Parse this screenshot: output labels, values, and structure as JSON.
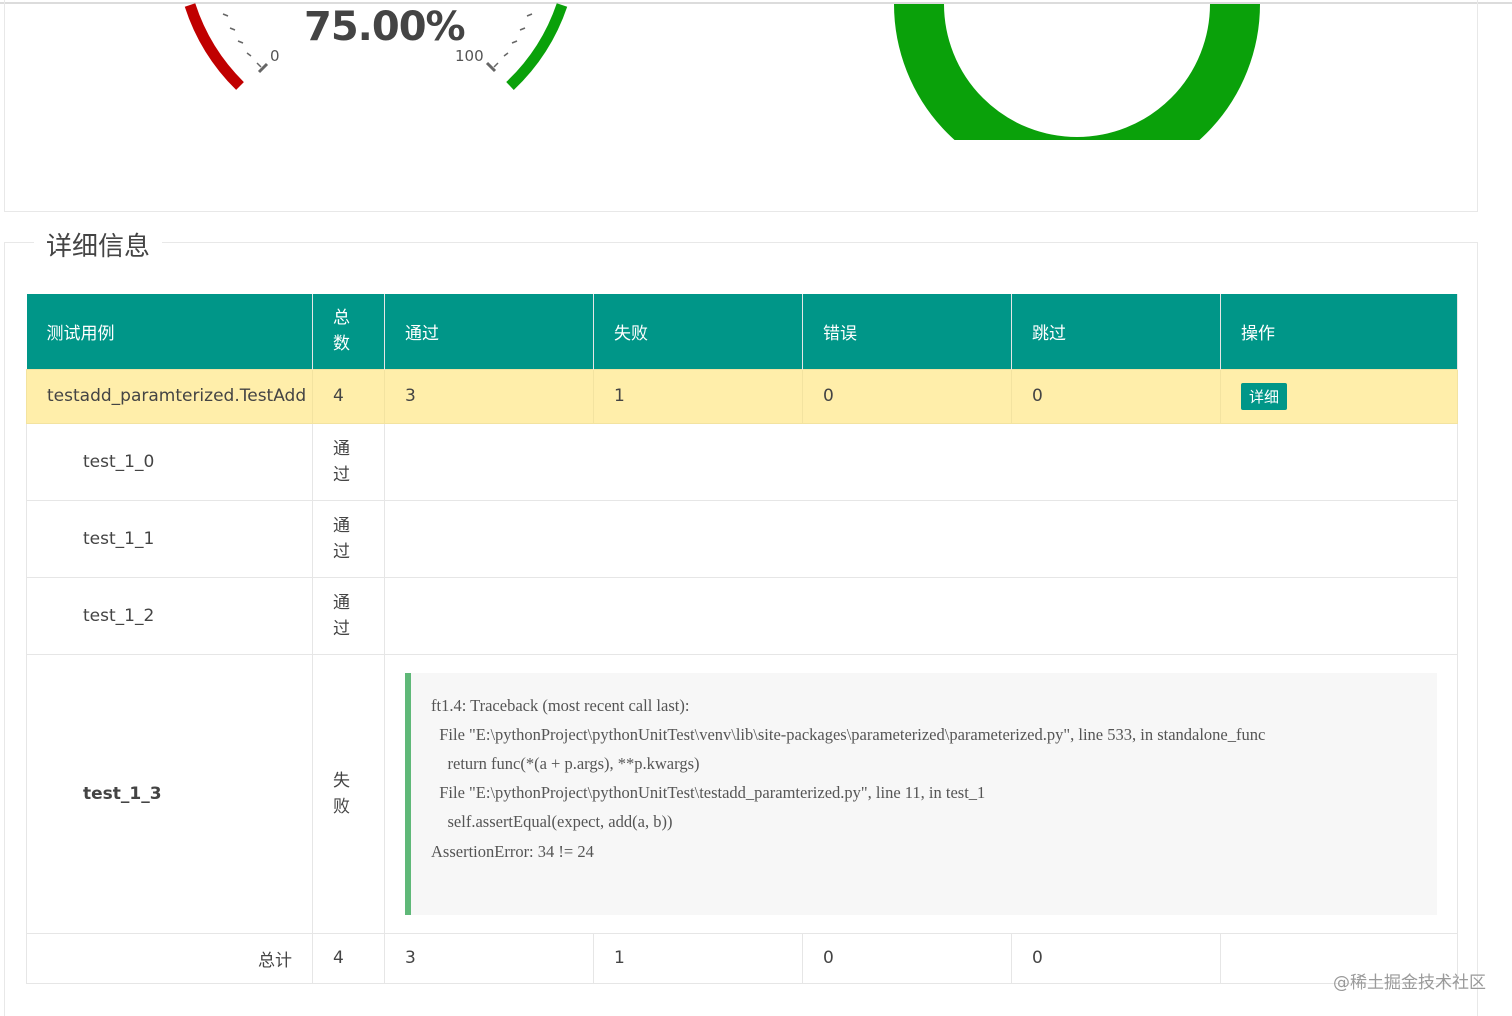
{
  "gauge": {
    "value_text": "75.00%",
    "percent": 75,
    "min_label": "0",
    "max_label": "100",
    "colors": {
      "low": "#c00000",
      "high": "#0aa10a"
    }
  },
  "donut": {
    "color": "#0aa10a"
  },
  "details": {
    "legend": "详细信息",
    "headers": [
      "测试用例",
      "总数",
      "通过",
      "失败",
      "错误",
      "跳过",
      "操作"
    ],
    "class_row": {
      "name": "testadd_paramterized.TestAdd",
      "total": "4",
      "pass": "3",
      "fail": "1",
      "error": "0",
      "skip": "0",
      "action": "详细"
    },
    "cases": [
      {
        "name": "test_1_0",
        "status": "通过"
      },
      {
        "name": "test_1_1",
        "status": "通过"
      },
      {
        "name": "test_1_2",
        "status": "通过"
      },
      {
        "name": "test_1_3",
        "status": "失败",
        "traceback": "ft1.4: Traceback (most recent call last):\n  File \"E:\\pythonProject\\pythonUnitTest\\venv\\lib\\site-packages\\parameterized\\parameterized.py\", line 533, in standalone_func\n    return func(*(a + p.args), **p.kwargs)\n  File \"E:\\pythonProject\\pythonUnitTest\\testadd_paramterized.py\", line 11, in test_1\n    self.assertEqual(expect, add(a, b))\nAssertionError: 34 != 24"
      }
    ],
    "total_row": {
      "label": "总计",
      "total": "4",
      "pass": "3",
      "fail": "1",
      "error": "0",
      "skip": "0"
    }
  },
  "watermark": "@稀土掘金技术社区",
  "colors": {
    "header_bg": "#009688",
    "class_row_bg": "#ffeeaa",
    "pass_text": "#3aa63a",
    "fail_text": "#e65100"
  }
}
